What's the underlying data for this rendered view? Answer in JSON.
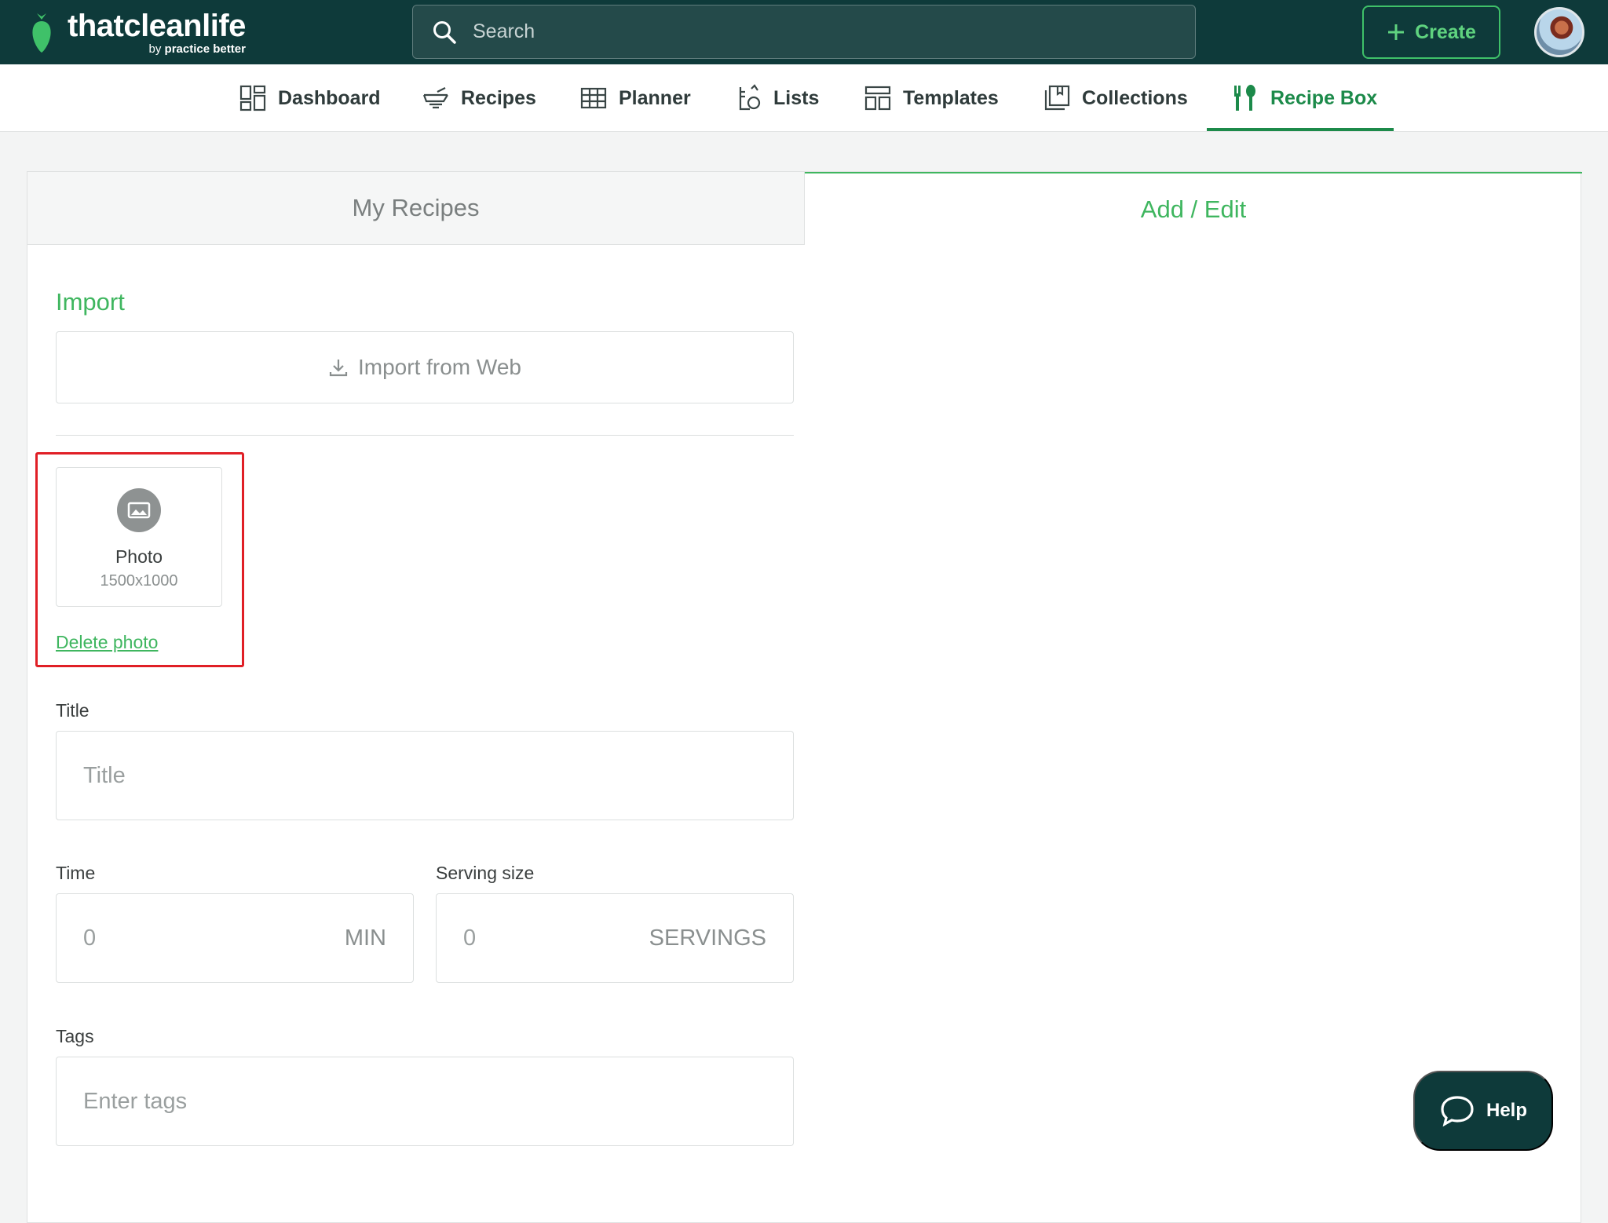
{
  "brand": {
    "name": "thatcleanlife",
    "sub_prefix": "by",
    "sub_name": "practice better",
    "accent": "#3fb65f",
    "dark": "#0e3a3a"
  },
  "header": {
    "search_placeholder": "Search",
    "create_label": "Create"
  },
  "nav": {
    "items": [
      {
        "label": "Dashboard",
        "icon": "dashboard-icon"
      },
      {
        "label": "Recipes",
        "icon": "recipes-icon"
      },
      {
        "label": "Planner",
        "icon": "planner-icon"
      },
      {
        "label": "Lists",
        "icon": "lists-icon"
      },
      {
        "label": "Templates",
        "icon": "templates-icon"
      },
      {
        "label": "Collections",
        "icon": "collections-icon"
      },
      {
        "label": "Recipe Box",
        "icon": "recipe-box-icon",
        "active": true
      }
    ]
  },
  "tabs": {
    "my_recipes": "My Recipes",
    "add_edit": "Add / Edit"
  },
  "form": {
    "import_title": "Import",
    "import_button": "Import from Web",
    "photo_label": "Photo",
    "photo_dims": "1500x1000",
    "delete_photo": "Delete photo",
    "title_label": "Title",
    "title_placeholder": "Title",
    "time_label": "Time",
    "time_placeholder": "0",
    "time_unit": "MIN",
    "serving_label": "Serving size",
    "serving_placeholder": "0",
    "serving_unit": "SERVINGS",
    "tags_label": "Tags",
    "tags_placeholder": "Enter tags"
  },
  "help": {
    "label": "Help"
  }
}
